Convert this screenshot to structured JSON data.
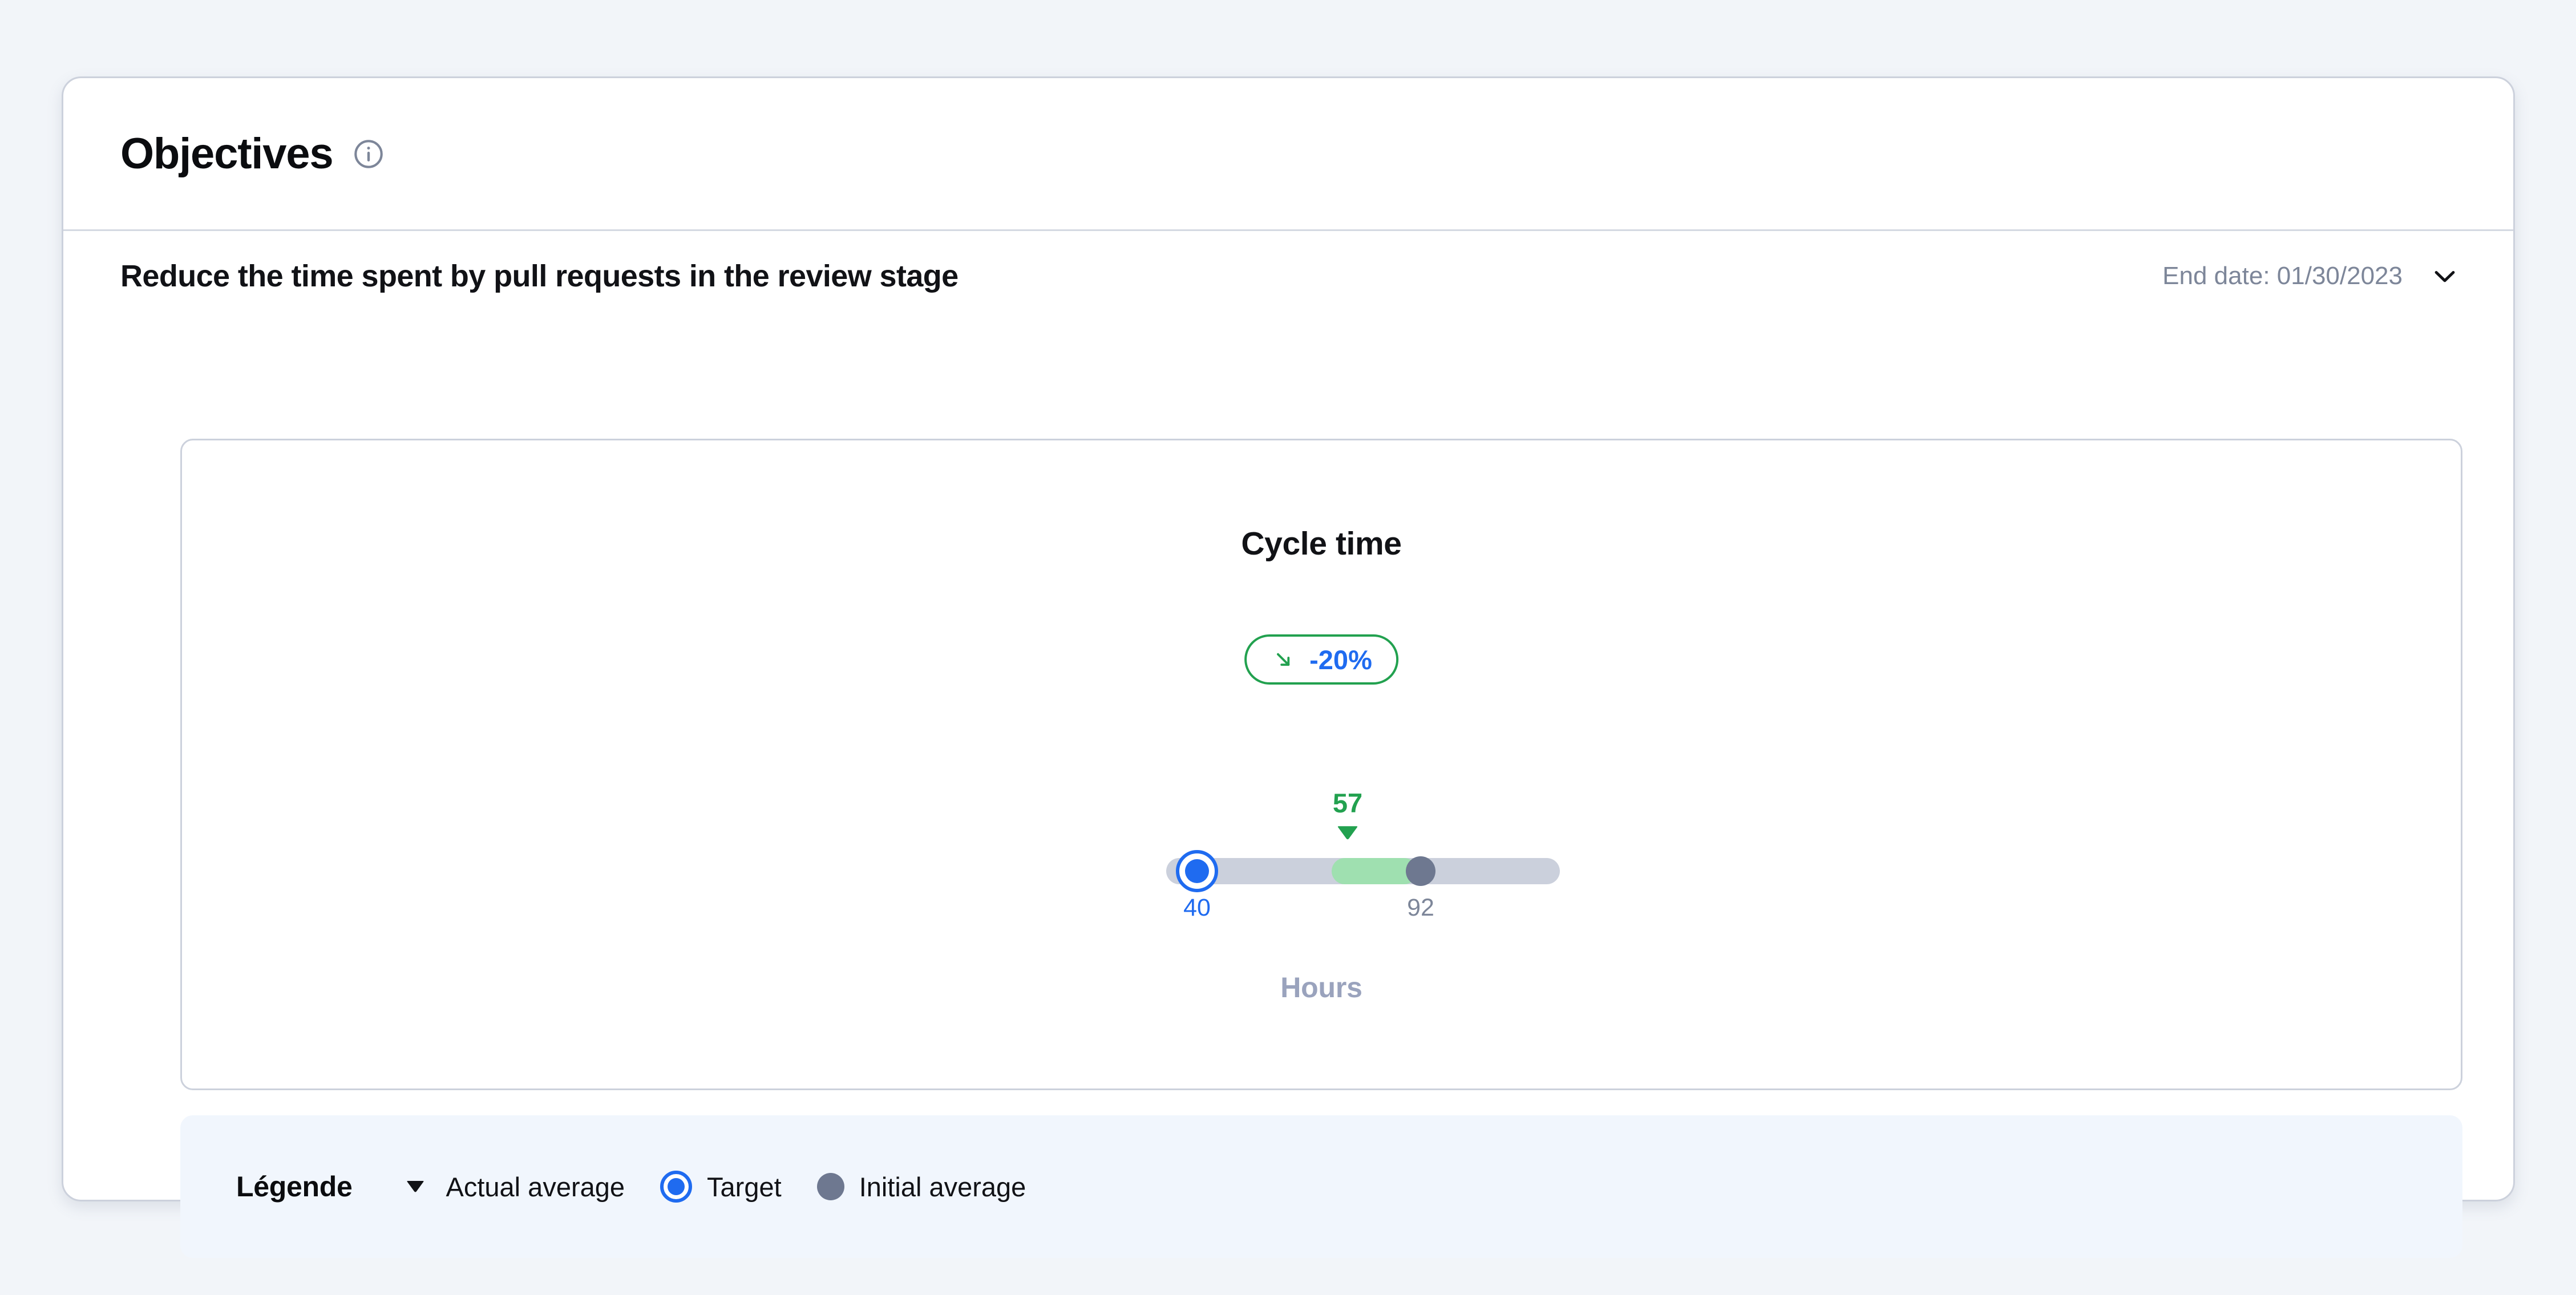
{
  "card": {
    "title": "Objectives",
    "info_icon": "info-circle-icon"
  },
  "objective": {
    "title": "Reduce the time spent by pull requests in the review stage",
    "end_date": "End date: 01/30/2023",
    "expand_icon": "chevron-down-icon"
  },
  "metric": {
    "title": "Cycle time",
    "unit": "Hours",
    "delta": {
      "value": "-20%",
      "direction_icon": "arrow-down-right-icon",
      "border_color": "#22a14f",
      "text_color": "#1f6bf0"
    }
  },
  "legend": {
    "title": "Légende",
    "items": [
      {
        "label": "Actual average",
        "marker": "caret-down-marker",
        "color": "#111216"
      },
      {
        "label": "Target",
        "marker": "ring-marker",
        "color": "#1f6bf0"
      },
      {
        "label": "Initial average",
        "marker": "solid-dot-marker",
        "color": "#6e7890"
      }
    ]
  },
  "chart_data": {
    "type": "bar",
    "title": "Cycle time",
    "xlabel": "Hours",
    "ylabel": "",
    "orientation": "horizontal",
    "grid": false,
    "legend_position": "bottom",
    "xlim": [
      0,
      140
    ],
    "categories": [
      "Target",
      "Actual average",
      "Initial average"
    ],
    "values": [
      40,
      57,
      92
    ],
    "series": [
      {
        "name": "Target",
        "value": 40,
        "color": "#1f6bf0",
        "marker": "ring"
      },
      {
        "name": "Actual average",
        "value": 57,
        "color": "#22a14f",
        "marker": "caret"
      },
      {
        "name": "Initial average",
        "value": 92,
        "color": "#6e7890",
        "marker": "dot"
      }
    ],
    "range_fill": {
      "from": 57,
      "to": 92,
      "color": "#9fe0b0"
    },
    "track_color": "#cbd0dc",
    "annotations": [
      {
        "text": "57",
        "value": 57,
        "color": "#22a14f"
      },
      {
        "text": "40",
        "value": 40,
        "color": "#1f6bf0"
      },
      {
        "text": "92",
        "value": 92,
        "color": "#7d8699"
      },
      {
        "text": "-20%",
        "color": "#1f6bf0"
      }
    ]
  }
}
